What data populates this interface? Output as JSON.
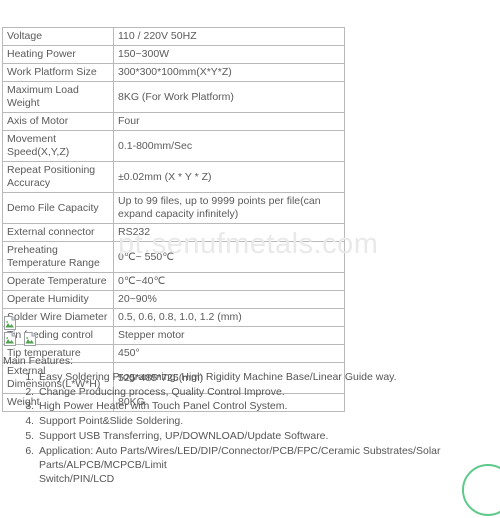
{
  "watermark": {
    "text": "pt.senufmetals.com"
  },
  "spec_table": {
    "name": "product-specification-table",
    "rows": [
      {
        "key": "Voltage",
        "value": "110 / 220V 50HZ"
      },
      {
        "key": "Heating Power",
        "value": "150~300W"
      },
      {
        "key": "Work Platform Size",
        "value": "300*300*100mm(X*Y*Z)"
      },
      {
        "key": "Maximum Load Weight",
        "value": "8KG (For Work Platform)"
      },
      {
        "key": "Axis of Motor",
        "value": "Four"
      },
      {
        "key": "Movement Speed(X,Y,Z)",
        "value": "0.1-800mm/Sec"
      },
      {
        "key": "Repeat Positioning Accuracy",
        "value": "±0.02mm (X * Y * Z)"
      },
      {
        "key": "Demo File Capacity",
        "value": "Up to 99 files, up to 9999 points per file(can expand capacity infinitely)"
      },
      {
        "key": "External connector",
        "value": "RS232"
      },
      {
        "key": "Preheating Temperature Range",
        "value": "0℃~ 550℃"
      },
      {
        "key": "Operate Temperature",
        "value": "0℃~40℃"
      },
      {
        "key": "Operate Humidity",
        "value": "20~90%"
      },
      {
        "key": "Solder Wire Diameter",
        "value": "0.5, 0.6, 0.8, 1.0, 1.2 (mm)"
      },
      {
        "key": "Tin feeding control",
        "value": "Stepper motor"
      },
      {
        "key": "Tip temperature",
        "value": "450°"
      },
      {
        "key": "External Dimensions(L*W*H)",
        "value": "525*485*725(mm)"
      },
      {
        "key": "Weight",
        "value": "80KG"
      }
    ]
  },
  "broken_images": {
    "icon_name": "broken-image-icon",
    "rows": [
      {
        "count": 1
      },
      {
        "count": 2
      }
    ]
  },
  "features": {
    "title": "Main Features:",
    "items": [
      {
        "text": "Easy Soldering Programming: High Rigidity Machine Base/Linear Guide way."
      },
      {
        "text": "Change Producing process, Quality Control Improve."
      },
      {
        "text": "High Power Heater with Touch Panel Control System."
      },
      {
        "text": "Support Point&Slide Soldering."
      },
      {
        "text": "Support USB Transferring, UP/DOWNLOAD/Update Software."
      },
      {
        "text": "Application: Auto Parts/Wires/LED/DIP/Connector/PCB/FPC/Ceramic Substrates/Solar Parts/ALPCB/MCPCB/Limit",
        "cont": "Switch/PIN/LCD"
      }
    ]
  },
  "colors": {
    "page_background": "#ffffff",
    "text": "#555555",
    "table_border": "#b9b9b9",
    "watermark": "#e9e9e9",
    "corner_arc": "#5ec98b"
  }
}
